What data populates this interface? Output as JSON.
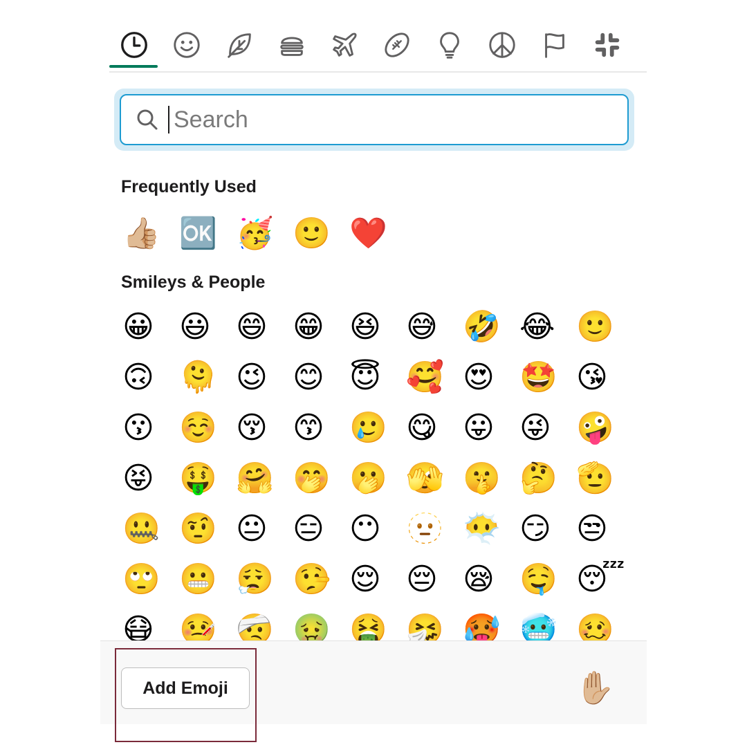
{
  "tabs": [
    {
      "name": "recent",
      "icon": "clock-icon"
    },
    {
      "name": "smileys",
      "icon": "smiley-icon"
    },
    {
      "name": "nature",
      "icon": "leaf-icon"
    },
    {
      "name": "food",
      "icon": "burger-icon"
    },
    {
      "name": "travel",
      "icon": "airplane-icon"
    },
    {
      "name": "activities",
      "icon": "football-icon"
    },
    {
      "name": "objects",
      "icon": "lightbulb-icon"
    },
    {
      "name": "symbols",
      "icon": "peace-icon"
    },
    {
      "name": "flags",
      "icon": "flag-icon"
    },
    {
      "name": "custom",
      "icon": "slack-icon"
    }
  ],
  "selected_tab": "recent",
  "accent_color": "#007a5a",
  "search": {
    "placeholder": "Search",
    "value": ""
  },
  "sections": {
    "frequent": {
      "title": "Frequently Used",
      "emojis": [
        "👍🏼",
        "🆗",
        "🥳",
        "🙂",
        "❤️"
      ]
    },
    "smileys": {
      "title": "Smileys & People",
      "emojis": [
        "😀",
        "😃",
        "😄",
        "😁",
        "😆",
        "😅",
        "🤣",
        "😂",
        "🙂",
        "🙃",
        "🫠",
        "😉",
        "😊",
        "😇",
        "🥰",
        "😍",
        "🤩",
        "😘",
        "😗",
        "☺️",
        "😚",
        "😙",
        "🥲",
        "😋",
        "😛",
        "😜",
        "🤪",
        "😝",
        "🤑",
        "🤗",
        "🤭",
        "🫢",
        "🫣",
        "🤫",
        "🤔",
        "🫡",
        "🤐",
        "🤨",
        "😐",
        "😑",
        "😶",
        "🫥",
        "😶‍🌫️",
        "😏",
        "😒",
        "🙄",
        "😬",
        "😮‍💨",
        "🤥",
        "😌",
        "😔",
        "😪",
        "🤤",
        "😴",
        "😷",
        "🤒",
        "🤕",
        "🤢",
        "🤮",
        "🤧",
        "🥵",
        "🥶",
        "🥴"
      ]
    }
  },
  "footer": {
    "add_button_label": "Add Emoji",
    "skin_tone_emoji": "✋🏼"
  }
}
